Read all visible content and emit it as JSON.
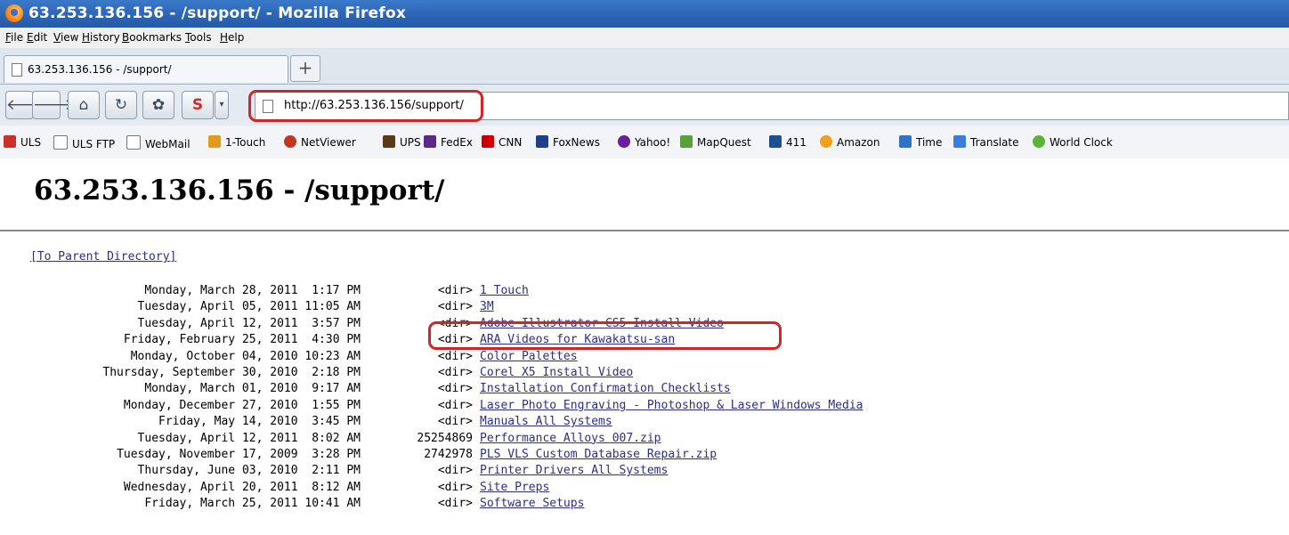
{
  "window": {
    "title": "63.253.136.156 - /support/ - Mozilla Firefox"
  },
  "menu": [
    "File",
    "Edit",
    "View",
    "History",
    "Bookmarks",
    "Tools",
    "Help"
  ],
  "tab": {
    "label": "63.253.136.156 - /support/",
    "new_tab": "+"
  },
  "nav": {
    "url": "http://63.253.136.156/support/"
  },
  "bookmarks": [
    "ULS",
    "ULS FTP",
    "WebMail",
    "1-Touch",
    "NetViewer",
    "UPS",
    "FedEx",
    "CNN",
    "FoxNews",
    "Yahoo!",
    "MapQuest",
    "411",
    "Amazon",
    "Time",
    "Translate",
    "World Clock"
  ],
  "page": {
    "heading": "63.253.136.156 - /support/",
    "parent_link": "[To Parent Directory]",
    "entries": [
      {
        "date": "Monday, March 28, 2011  1:17 PM",
        "size": "<dir>",
        "name": "1 Touch"
      },
      {
        "date": "Tuesday, April 05, 2011 11:05 AM",
        "size": "<dir>",
        "name": "3M"
      },
      {
        "date": "Tuesday, April 12, 2011  3:57 PM",
        "size": "<dir>",
        "name": "Adobe Illustrator CS5 Install Video"
      },
      {
        "date": "Friday, February 25, 2011  4:30 PM",
        "size": "<dir>",
        "name": "ARA Videos for Kawakatsu-san"
      },
      {
        "date": "Monday, October 04, 2010 10:23 AM",
        "size": "<dir>",
        "name": "Color Palettes"
      },
      {
        "date": "Thursday, September 30, 2010  2:18 PM",
        "size": "<dir>",
        "name": "Corel X5 Install Video"
      },
      {
        "date": "Monday, March 01, 2010  9:17 AM",
        "size": "<dir>",
        "name": "Installation Confirmation Checklists"
      },
      {
        "date": "Monday, December 27, 2010  1:55 PM",
        "size": "<dir>",
        "name": "Laser Photo Engraving - Photoshop & Laser Windows Media"
      },
      {
        "date": "Friday, May 14, 2010  3:45 PM",
        "size": "<dir>",
        "name": "Manuals All Systems"
      },
      {
        "date": "Tuesday, April 12, 2011  8:02 AM",
        "size": "25254869",
        "name": "Performance Alloys 007.zip"
      },
      {
        "date": "Tuesday, November 17, 2009  3:28 PM",
        "size": "2742978",
        "name": "PLS VLS Custom Database Repair.zip"
      },
      {
        "date": "Thursday, June 03, 2010  2:11 PM",
        "size": "<dir>",
        "name": "Printer Drivers All Systems"
      },
      {
        "date": "Wednesday, April 20, 2011  8:12 AM",
        "size": "<dir>",
        "name": "Site Preps"
      },
      {
        "date": "Friday, March 25, 2011 10:41 AM",
        "size": "<dir>",
        "name": "Software Setups"
      }
    ]
  }
}
